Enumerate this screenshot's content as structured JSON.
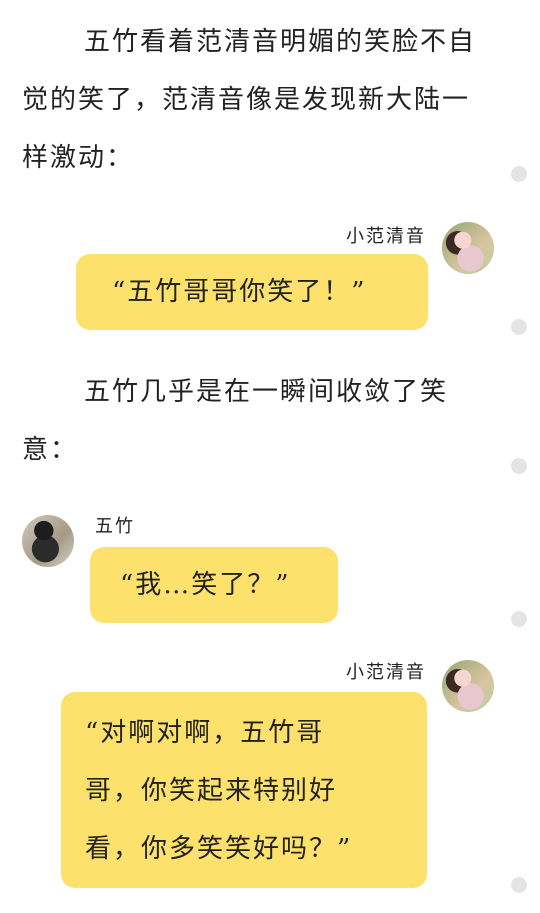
{
  "narration": [
    {
      "text": "五竹看着范清音明媚的笑脸不自觉的笑了，范清音像是发现新大陆一样激动："
    },
    {
      "text": "五竹几乎是在一瞬间收敛了笑意："
    }
  ],
  "messages": [
    {
      "speaker": "小范清音",
      "text": "“五竹哥哥你笑了！”",
      "side": "right"
    },
    {
      "speaker": "五竹",
      "text": "“我…笑了？”",
      "side": "left"
    },
    {
      "speaker": "小范清音",
      "text_lines": [
        "“对啊对啊，五竹哥",
        "哥，你笑起来特别好",
        "看，你多笑笑好吗？”"
      ],
      "side": "right"
    }
  ]
}
